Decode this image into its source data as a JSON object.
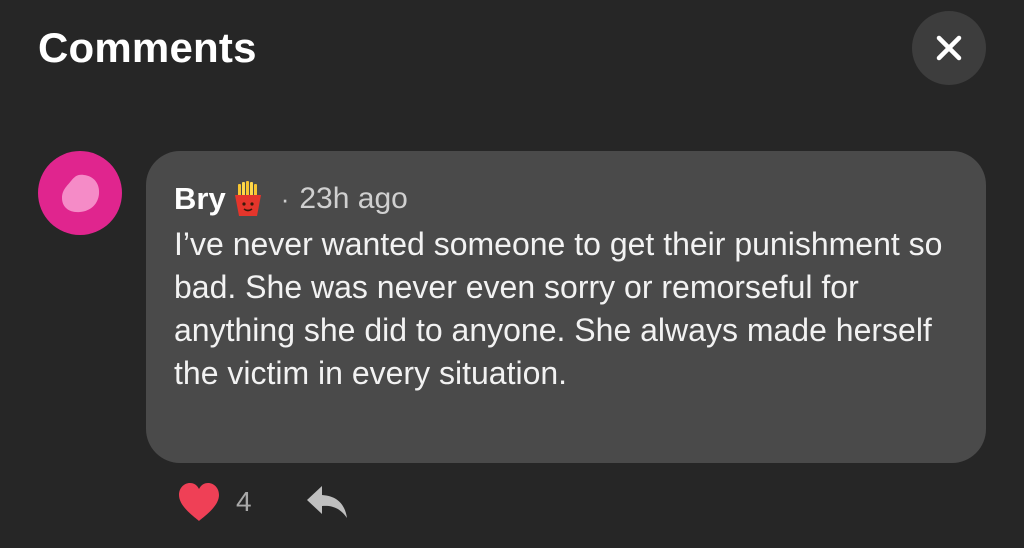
{
  "header": {
    "title": "Comments",
    "close_icon": "close-icon"
  },
  "comment": {
    "avatar_icon": "avatar-blob-icon",
    "avatar_color": "#e0258e",
    "author": "Bry",
    "author_badge_icon": "french-fries-emoji",
    "separator": "·",
    "timestamp": "23h ago",
    "text": "I’ve never wanted someone to get their punishment so bad. She was never even sorry or remorseful for anything she did to anyone. She always made herself the victim in every situation.",
    "like_icon": "heart-icon",
    "like_color": "#ef4056",
    "like_count": "4",
    "reply_icon": "reply-arrow-icon"
  }
}
